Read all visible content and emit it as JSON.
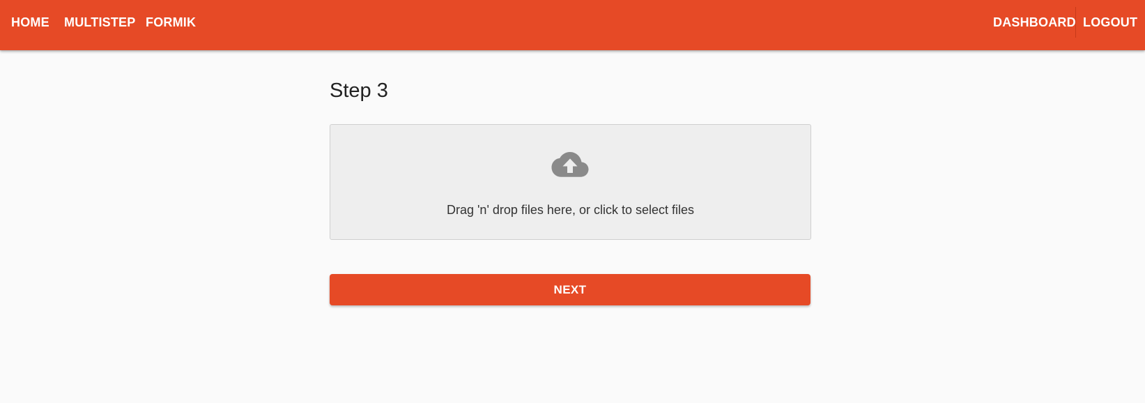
{
  "appbar": {
    "color": "#e64a26",
    "left_links": [
      "HOME",
      "MULTISTEP",
      "FORMIK"
    ],
    "right_links": [
      "DASHBOARD",
      "LOGOUT"
    ]
  },
  "main": {
    "title": "Step 3",
    "dropzone": {
      "icon": "cloud-upload-icon",
      "text": "Drag 'n' drop files here, or click to select files"
    },
    "next_label": "NEXT"
  }
}
